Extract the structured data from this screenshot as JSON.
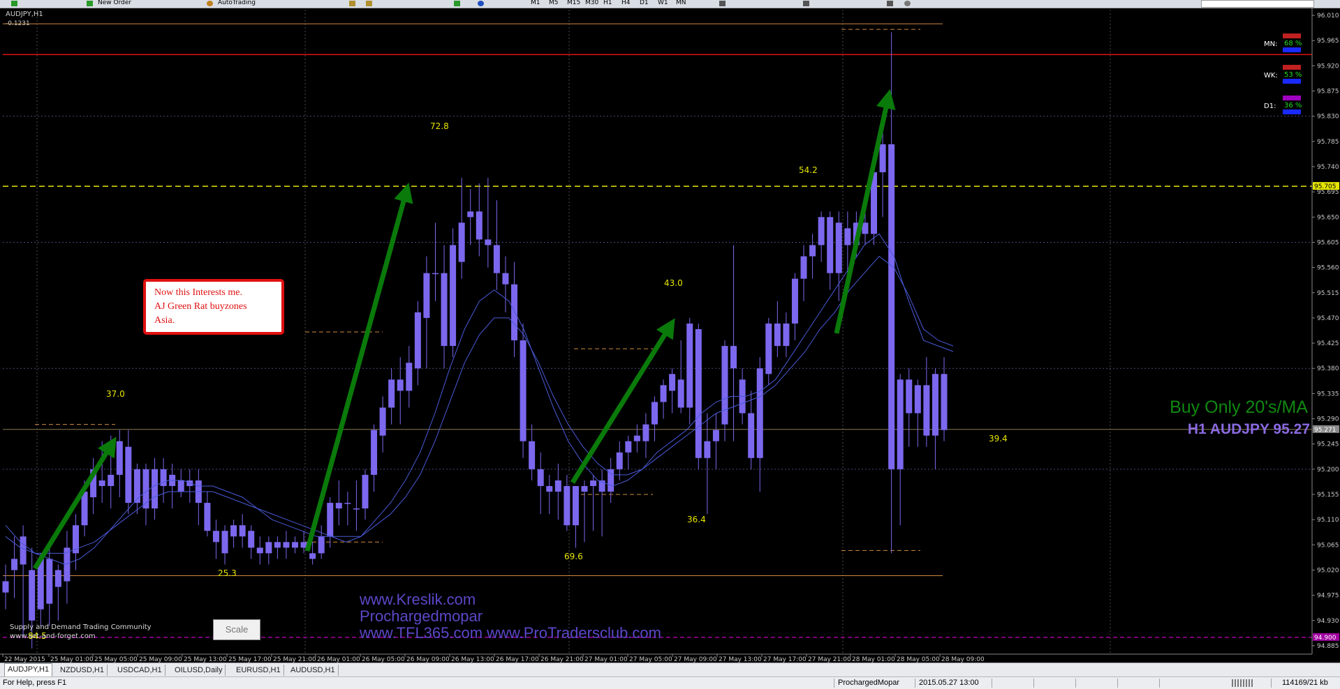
{
  "toolbar": {
    "new_order_label": "New Order",
    "autotrading_label": "AutoTrading",
    "timeframes": [
      "M1",
      "M5",
      "M15",
      "M30",
      "H1",
      "H4",
      "D1",
      "W1",
      "MN"
    ]
  },
  "chart": {
    "symbol_label": "AUDJPY,H1",
    "indicator_value": "-0.1231",
    "big_text_line1": "Buy Only 20's/MA",
    "big_text_line2": "H1 AUDJPY 95.27",
    "watermark_line1": "www.Kreslik.com",
    "watermark_line2": "Prochargedmopar",
    "watermark_line3": "www.TFL365.com  www.ProTradersclub.com",
    "community_line1": "Supply and Demand Trading Community",
    "community_line2": "www.set-and-forget.com",
    "note_text_line1": "Now this Interests me.",
    "note_text_line2": "AJ Green Rat buyzones",
    "note_text_line3": "Asia.",
    "scale_button": "Scale",
    "current_price_tag": "95.271",
    "yellow_line_tag": "95.705",
    "purple_line_tag": "94.900",
    "strength": [
      {
        "label": "MN:",
        "value": "68 %"
      },
      {
        "label": "WK:",
        "value": "53 %"
      },
      {
        "label": "D1:",
        "value": "36 %"
      }
    ],
    "move_labels": [
      "37.0",
      "72.8",
      "43.0",
      "54.2",
      "25.3",
      "69.6",
      "36.4",
      "39.4",
      "84.5"
    ],
    "colors": {
      "candle": "#7b68ee",
      "ma": "#4a5ad8",
      "arrow": "#0a7a0a",
      "yellow_line": "#e6e600",
      "red_line": "#e01010",
      "purple_line": "#a000a0",
      "orange_zone": "#d08a40",
      "big_green": "#118811",
      "big_purple": "#8a6ae0"
    }
  },
  "chart_data": {
    "type": "candlestick",
    "title": "AUDJPY,H1",
    "y_ticks": [
      "96.010",
      "95.965",
      "95.920",
      "95.875",
      "95.830",
      "95.785",
      "95.740",
      "95.695",
      "95.650",
      "95.605",
      "95.560",
      "95.515",
      "95.470",
      "95.425",
      "95.380",
      "95.335",
      "95.290",
      "95.245",
      "95.200",
      "95.155",
      "95.110",
      "95.065",
      "95.020",
      "94.975",
      "94.930",
      "94.885"
    ],
    "x_ticks": [
      "22 May 2015",
      "25 May 01:00",
      "25 May 05:00",
      "25 May 09:00",
      "25 May 13:00",
      "25 May 17:00",
      "25 May 21:00",
      "26 May 01:00",
      "26 May 05:00",
      "26 May 09:00",
      "26 May 13:00",
      "26 May 17:00",
      "26 May 21:00",
      "27 May 01:00",
      "27 May 05:00",
      "27 May 09:00",
      "27 May 13:00",
      "27 May 17:00",
      "27 May 21:00",
      "28 May 01:00",
      "28 May 05:00",
      "28 May 09:00"
    ],
    "ylim": [
      94.87,
      96.02
    ],
    "horizontal_lines": {
      "yellow_dashed": 95.705,
      "red": 95.94,
      "purple_dashed": 94.9,
      "current_price": 95.271
    },
    "candles": [
      [
        95.0,
        95.03,
        94.95,
        94.98
      ],
      [
        95.04,
        95.08,
        94.97,
        95.02
      ],
      [
        95.03,
        95.1,
        94.9,
        95.08
      ],
      [
        94.93,
        95.06,
        94.88,
        95.02
      ],
      [
        95.04,
        95.05,
        94.92,
        94.95
      ],
      [
        94.96,
        95.06,
        94.92,
        95.04
      ],
      [
        94.99,
        95.03,
        94.93,
        95.02
      ],
      [
        95.0,
        95.09,
        94.96,
        95.06
      ],
      [
        95.05,
        95.12,
        95.02,
        95.1
      ],
      [
        95.1,
        95.18,
        95.08,
        95.16
      ],
      [
        95.15,
        95.22,
        95.12,
        95.2
      ],
      [
        95.18,
        95.25,
        95.14,
        95.17
      ],
      [
        95.17,
        95.26,
        95.13,
        95.19
      ],
      [
        95.19,
        95.27,
        95.15,
        95.25
      ],
      [
        95.24,
        95.27,
        95.12,
        95.14
      ],
      [
        95.14,
        95.21,
        95.12,
        95.2
      ],
      [
        95.2,
        95.21,
        95.1,
        95.13
      ],
      [
        95.13,
        95.22,
        95.11,
        95.2
      ],
      [
        95.2,
        95.22,
        95.14,
        95.17
      ],
      [
        95.17,
        95.21,
        95.13,
        95.19
      ],
      [
        95.18,
        95.2,
        95.15,
        95.16
      ],
      [
        95.17,
        95.2,
        95.14,
        95.18
      ],
      [
        95.18,
        95.2,
        95.1,
        95.14
      ],
      [
        95.14,
        95.16,
        95.08,
        95.09
      ],
      [
        95.09,
        95.11,
        95.04,
        95.07
      ],
      [
        95.05,
        95.1,
        95.03,
        95.09
      ],
      [
        95.08,
        95.11,
        95.06,
        95.1
      ],
      [
        95.1,
        95.12,
        95.06,
        95.08
      ],
      [
        95.09,
        95.1,
        95.04,
        95.06
      ],
      [
        95.06,
        95.08,
        95.03,
        95.05
      ],
      [
        95.05,
        95.08,
        95.03,
        95.07
      ],
      [
        95.06,
        95.08,
        95.04,
        95.07
      ],
      [
        95.07,
        95.09,
        95.04,
        95.06
      ],
      [
        95.06,
        95.08,
        95.05,
        95.07
      ],
      [
        95.07,
        95.09,
        95.05,
        95.06
      ],
      [
        95.05,
        95.07,
        95.03,
        95.04
      ],
      [
        95.05,
        95.1,
        95.04,
        95.08
      ],
      [
        95.08,
        95.15,
        95.06,
        95.14
      ],
      [
        95.13,
        95.18,
        95.1,
        95.14
      ],
      [
        95.14,
        95.16,
        95.1,
        95.14
      ],
      [
        95.13,
        95.18,
        95.09,
        95.13
      ],
      [
        95.13,
        95.2,
        95.11,
        95.19
      ],
      [
        95.19,
        95.28,
        95.16,
        95.27
      ],
      [
        95.26,
        95.33,
        95.23,
        95.31
      ],
      [
        95.31,
        95.38,
        95.28,
        95.36
      ],
      [
        95.36,
        95.4,
        95.28,
        95.34
      ],
      [
        95.34,
        95.42,
        95.31,
        95.39
      ],
      [
        95.38,
        95.5,
        95.35,
        95.48
      ],
      [
        95.47,
        95.58,
        95.38,
        95.55
      ],
      [
        95.55,
        95.64,
        95.5,
        95.55
      ],
      [
        95.55,
        95.6,
        95.38,
        95.42
      ],
      [
        95.42,
        95.63,
        95.4,
        95.6
      ],
      [
        95.57,
        95.72,
        95.54,
        95.64
      ],
      [
        95.65,
        95.7,
        95.6,
        95.66
      ],
      [
        95.66,
        95.71,
        95.58,
        95.61
      ],
      [
        95.61,
        95.72,
        95.56,
        95.6
      ],
      [
        95.6,
        95.68,
        95.52,
        95.55
      ],
      [
        95.55,
        95.58,
        95.48,
        95.53
      ],
      [
        95.53,
        95.57,
        95.4,
        95.43
      ],
      [
        95.43,
        95.46,
        95.22,
        95.25
      ],
      [
        95.25,
        95.28,
        95.18,
        95.2
      ],
      [
        95.2,
        95.23,
        95.12,
        95.17
      ],
      [
        95.17,
        95.19,
        95.12,
        95.16
      ],
      [
        95.16,
        95.21,
        95.11,
        95.18
      ],
      [
        95.17,
        95.19,
        95.09,
        95.1
      ],
      [
        95.1,
        95.17,
        95.06,
        95.17
      ],
      [
        95.16,
        95.18,
        95.07,
        95.17
      ],
      [
        95.17,
        95.19,
        95.09,
        95.18
      ],
      [
        95.18,
        95.2,
        95.08,
        95.16
      ],
      [
        95.16,
        95.22,
        95.14,
        95.2
      ],
      [
        95.2,
        95.25,
        95.18,
        95.23
      ],
      [
        95.23,
        95.26,
        95.2,
        95.25
      ],
      [
        95.25,
        95.28,
        95.23,
        95.26
      ],
      [
        95.25,
        95.3,
        95.22,
        95.28
      ],
      [
        95.28,
        95.33,
        95.25,
        95.32
      ],
      [
        95.32,
        95.36,
        95.29,
        95.35
      ],
      [
        95.34,
        95.38,
        95.3,
        95.37
      ],
      [
        95.36,
        95.43,
        95.3,
        95.31
      ],
      [
        95.31,
        95.47,
        95.28,
        95.46
      ],
      [
        95.45,
        95.46,
        95.2,
        95.22
      ],
      [
        95.22,
        95.3,
        95.12,
        95.25
      ],
      [
        95.25,
        95.3,
        95.2,
        95.27
      ],
      [
        95.28,
        95.43,
        95.25,
        95.42
      ],
      [
        95.42,
        95.6,
        95.25,
        95.38
      ],
      [
        95.36,
        95.38,
        95.28,
        95.3
      ],
      [
        95.3,
        95.34,
        95.2,
        95.22
      ],
      [
        95.22,
        95.4,
        95.16,
        95.38
      ],
      [
        95.37,
        95.47,
        95.35,
        95.46
      ],
      [
        95.46,
        95.5,
        95.4,
        95.42
      ],
      [
        95.42,
        95.48,
        95.4,
        95.46
      ],
      [
        95.46,
        95.55,
        95.43,
        95.54
      ],
      [
        95.54,
        95.6,
        95.5,
        95.58
      ],
      [
        95.58,
        95.62,
        95.54,
        95.6
      ],
      [
        95.6,
        95.66,
        95.57,
        95.65
      ],
      [
        95.65,
        95.66,
        95.52,
        95.55
      ],
      [
        95.55,
        95.66,
        95.5,
        95.64
      ],
      [
        95.63,
        95.66,
        95.55,
        95.6
      ],
      [
        95.6,
        95.66,
        95.58,
        95.64
      ],
      [
        95.64,
        95.68,
        95.6,
        95.62
      ],
      [
        95.62,
        95.75,
        95.6,
        95.73
      ],
      [
        95.73,
        95.8,
        95.65,
        95.78
      ],
      [
        95.78,
        95.98,
        95.05,
        95.2
      ],
      [
        95.2,
        95.37,
        95.1,
        95.36
      ],
      [
        95.36,
        95.38,
        95.24,
        95.3
      ],
      [
        95.3,
        95.36,
        95.24,
        95.35
      ],
      [
        95.35,
        95.4,
        95.24,
        95.26
      ],
      [
        95.26,
        95.38,
        95.2,
        95.37
      ],
      [
        95.37,
        95.4,
        95.25,
        95.27
      ]
    ],
    "series": [
      {
        "name": "MA fast",
        "values": [
          95.1,
          95.07,
          95.05,
          95.04,
          95.03,
          95.04,
          95.06,
          95.09,
          95.12,
          95.15,
          95.17,
          95.18,
          95.18,
          95.17,
          95.17,
          95.16,
          95.15,
          95.13,
          95.11,
          95.1,
          95.09,
          95.08,
          95.08,
          95.07,
          95.08,
          95.11,
          95.14,
          95.18,
          95.23,
          95.3,
          95.38,
          95.45,
          95.5,
          95.52,
          95.5,
          95.45,
          95.38,
          95.31,
          95.25,
          95.21,
          95.18,
          95.17,
          95.18,
          95.2,
          95.23,
          95.25,
          95.27,
          95.3,
          95.32,
          95.33,
          95.33,
          95.34,
          95.36,
          95.4,
          95.44,
          95.48,
          95.52,
          95.56,
          95.6,
          95.62,
          95.58,
          95.5,
          95.43,
          95.42,
          95.41
        ]
      },
      {
        "name": "MA slow",
        "values": [
          95.08,
          95.06,
          95.05,
          95.05,
          95.05,
          95.06,
          95.07,
          95.09,
          95.11,
          95.13,
          95.15,
          95.16,
          95.16,
          95.16,
          95.16,
          95.15,
          95.14,
          95.13,
          95.12,
          95.11,
          95.1,
          95.09,
          95.08,
          95.08,
          95.08,
          95.1,
          95.12,
          95.15,
          95.19,
          95.25,
          95.32,
          95.39,
          95.44,
          95.47,
          95.47,
          95.44,
          95.39,
          95.33,
          95.28,
          95.24,
          95.21,
          95.19,
          95.19,
          95.2,
          95.22,
          95.24,
          95.26,
          95.28,
          95.3,
          95.31,
          95.32,
          95.33,
          95.35,
          95.38,
          95.41,
          95.45,
          95.48,
          95.52,
          95.55,
          95.58,
          95.56,
          95.51,
          95.45,
          95.43,
          95.42
        ]
      }
    ]
  },
  "tabs": [
    "AUDJPY,H1",
    "NZDUSD,H1",
    "USDCAD,H1",
    "OILUSD,Daily",
    "EURUSD,H1",
    "AUDUSD,H1"
  ],
  "status": {
    "help_text": "For Help, press F1",
    "profile": "ProchargedMopar",
    "datetime": "2015.05.27 13:00",
    "traffic": "114169/21 kb"
  }
}
